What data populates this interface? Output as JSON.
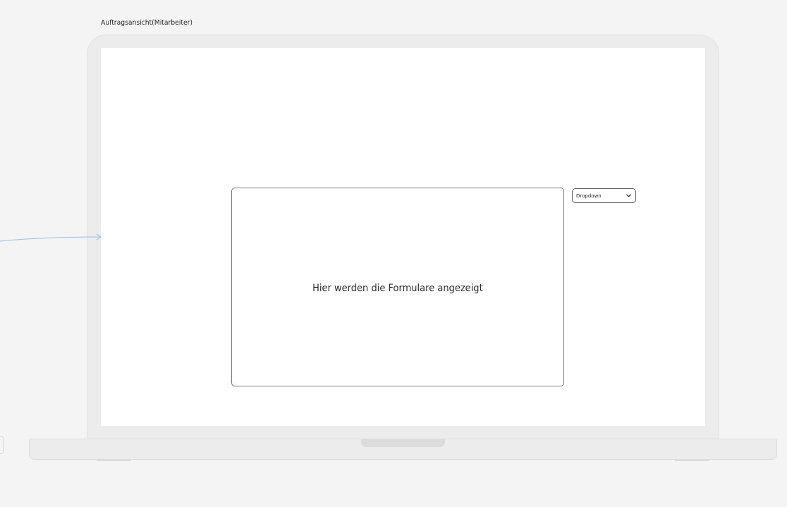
{
  "frame": {
    "title": "Auftragsansicht(Mitarbeiter)"
  },
  "screen": {
    "form_area": {
      "placeholder_text": "Hier werden die Formulare angezeigt"
    },
    "dropdown": {
      "label": "Dropdown",
      "icon": "chevron-down-icon"
    }
  },
  "colors": {
    "canvas_background": "#f4f4f4",
    "device_body": "#ececec",
    "screen": "#ffffff",
    "connector_line": "#9cc9f2",
    "border": "#7a7a7a"
  }
}
